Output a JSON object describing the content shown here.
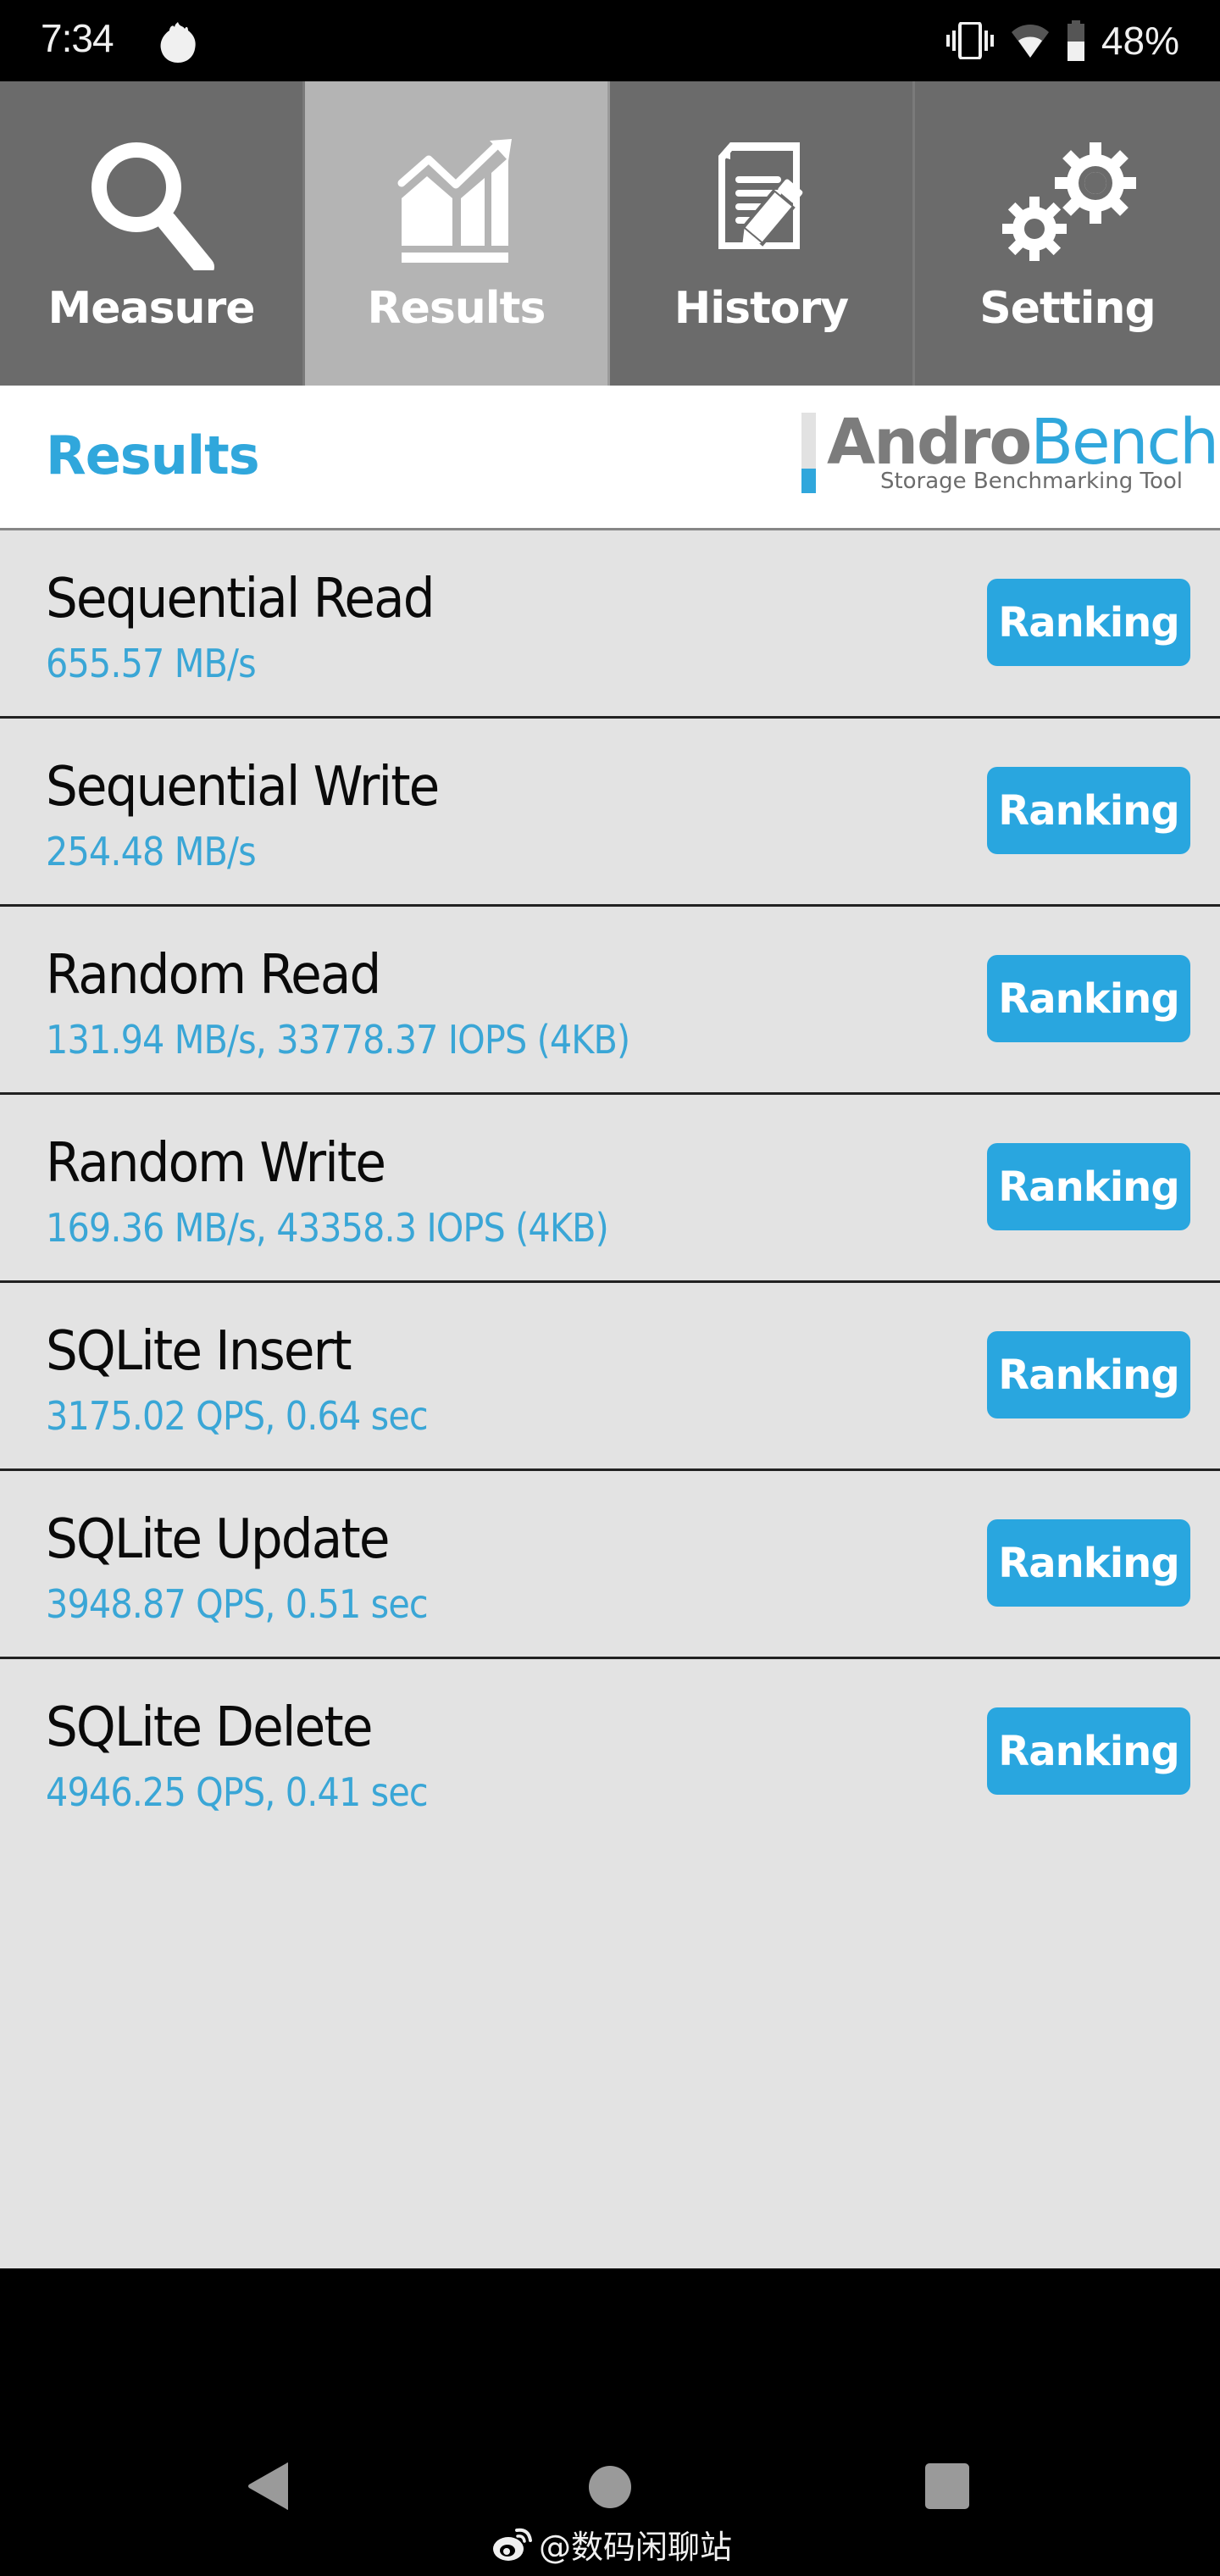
{
  "status_bar": {
    "time": "7:34",
    "battery_percent": "48%",
    "battery_level": 0.48,
    "icons": [
      "flame-icon",
      "vibrate-icon",
      "wifi-icon",
      "battery-icon"
    ]
  },
  "tabs": [
    {
      "label": "Measure",
      "icon": "search-icon",
      "active": false
    },
    {
      "label": "Results",
      "icon": "chart-icon",
      "active": true
    },
    {
      "label": "History",
      "icon": "document-edit-icon",
      "active": false
    },
    {
      "label": "Setting",
      "icon": "gears-icon",
      "active": false
    }
  ],
  "header": {
    "title": "Results",
    "logo": {
      "name_part1": "Andro",
      "name_part2": "Bench",
      "tagline": "Storage Benchmarking Tool"
    }
  },
  "results": [
    {
      "name": "Sequential Read",
      "value": "655.57 MB/s",
      "button": "Ranking"
    },
    {
      "name": "Sequential Write",
      "value": "254.48 MB/s",
      "button": "Ranking"
    },
    {
      "name": "Random Read",
      "value": "131.94 MB/s, 33778.37 IOPS (4KB)",
      "button": "Ranking"
    },
    {
      "name": "Random Write",
      "value": "169.36 MB/s, 43358.3 IOPS (4KB)",
      "button": "Ranking"
    },
    {
      "name": "SQLite Insert",
      "value": "3175.02 QPS, 0.64 sec",
      "button": "Ranking"
    },
    {
      "name": "SQLite Update",
      "value": "3948.87 QPS, 0.51 sec",
      "button": "Ranking"
    },
    {
      "name": "SQLite Delete",
      "value": "4946.25 QPS, 0.41 sec",
      "button": "Ranking"
    }
  ],
  "nav_bar": {
    "buttons": [
      "back",
      "home",
      "recents"
    ]
  },
  "watermark": "@数码闲聊站",
  "colors": {
    "accent": "#29a6df",
    "value_text": "#3aa6d6",
    "tab_inactive": "#6b6b6b",
    "tab_active": "#b4b4b4",
    "content_bg": "#e3e3e3"
  }
}
